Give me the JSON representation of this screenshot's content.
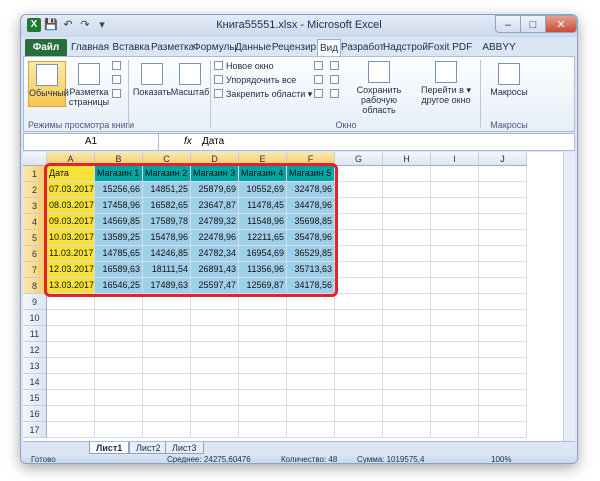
{
  "window": {
    "title": "Книга55551.xlsx - Microsoft Excel",
    "min": "–",
    "max": "□",
    "close": "✕"
  },
  "qat": {
    "logo": "X",
    "save": "💾",
    "undo": "↶",
    "redo": "↷",
    "more": "▾"
  },
  "tabs": [
    {
      "label": "Файл"
    },
    {
      "label": "Главная"
    },
    {
      "label": "Вставка"
    },
    {
      "label": "Разметка"
    },
    {
      "label": "Формулы"
    },
    {
      "label": "Данные"
    },
    {
      "label": "Рецензир"
    },
    {
      "label": "Вид"
    },
    {
      "label": "Разработ"
    },
    {
      "label": "Надстрой"
    },
    {
      "label": "Foxit PDF"
    },
    {
      "label": "ABBYY PDF"
    }
  ],
  "ribbon": {
    "normal": "Обычный",
    "pagelayout_l1": "Разметка",
    "pagelayout_l2": "страницы",
    "group1": "Режимы просмотра книги",
    "show": "Показать",
    "zoom": "Масштаб",
    "new_window": "Новое окно",
    "arrange": "Упорядочить все",
    "freeze": "Закрепить области",
    "save_ws_l1": "Сохранить",
    "save_ws_l2": "рабочую область",
    "switch_l1": "Перейти в",
    "switch_l2": "другое окно",
    "group_window": "Окно",
    "macros": "Макросы",
    "group_macros": "Макросы"
  },
  "formula_bar": {
    "name_box": "A1",
    "fx": "fx",
    "value": "Дата"
  },
  "columns": [
    "A",
    "B",
    "C",
    "D",
    "E",
    "F",
    "G",
    "H",
    "I",
    "J"
  ],
  "rows": [
    "1",
    "2",
    "3",
    "4",
    "5",
    "6",
    "7",
    "8",
    "9",
    "10",
    "11",
    "12",
    "13",
    "14",
    "15",
    "16",
    "17"
  ],
  "table": {
    "headers": [
      "Дата",
      "Магазин 1",
      "Магазин 2",
      "Магазин 3",
      "Магазин 4",
      "Магазин 5"
    ],
    "rows": [
      [
        "07.03.2017",
        "15256,66",
        "14851,25",
        "25879,69",
        "10552,69",
        "32478,96"
      ],
      [
        "08.03.2017",
        "17458,96",
        "16582,65",
        "23647,87",
        "11478,45",
        "34478,96"
      ],
      [
        "09.03.2017",
        "14569,85",
        "17589,78",
        "24789,32",
        "11548,96",
        "35698,85"
      ],
      [
        "10.03.2017",
        "13589,25",
        "15478,96",
        "22478,96",
        "12211,65",
        "35478,96"
      ],
      [
        "11.03.2017",
        "14785,65",
        "14246,85",
        "24782,34",
        "16954,69",
        "36529,85"
      ],
      [
        "12.03.2017",
        "16589,63",
        "18111,54",
        "26891,43",
        "11356,96",
        "35713,63"
      ],
      [
        "13.03.2017",
        "16546,25",
        "17489,63",
        "25597,47",
        "12569,87",
        "34178,56"
      ]
    ]
  },
  "sheets": [
    {
      "label": "Лист1"
    },
    {
      "label": "Лист2"
    },
    {
      "label": "Лист3"
    }
  ],
  "status": {
    "ready": "Готово",
    "average": "Среднее: 24275,60476",
    "count": "Количество: 48",
    "sum": "Сумма: 1019575,4",
    "zoom": "100%"
  },
  "colors": {
    "header_row": "#00a4a4",
    "date_col": "#f7e23a",
    "data_fill": "#9ecfe8",
    "border_red": "#e0232f"
  }
}
